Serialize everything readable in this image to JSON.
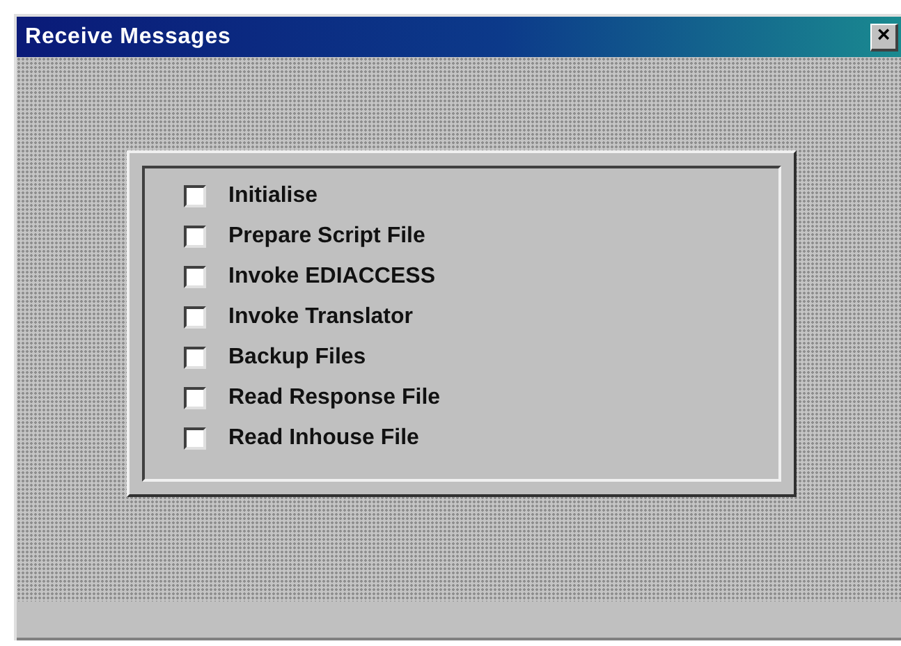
{
  "window": {
    "title": "Receive Messages",
    "close": "×"
  },
  "steps": [
    {
      "label": "Initialise",
      "checked": false
    },
    {
      "label": "Prepare Script File",
      "checked": false
    },
    {
      "label": "Invoke EDIACCESS",
      "checked": false
    },
    {
      "label": "Invoke Translator",
      "checked": false
    },
    {
      "label": "Backup Files",
      "checked": false
    },
    {
      "label": "Read Response File",
      "checked": false
    },
    {
      "label": "Read Inhouse File",
      "checked": false
    }
  ]
}
